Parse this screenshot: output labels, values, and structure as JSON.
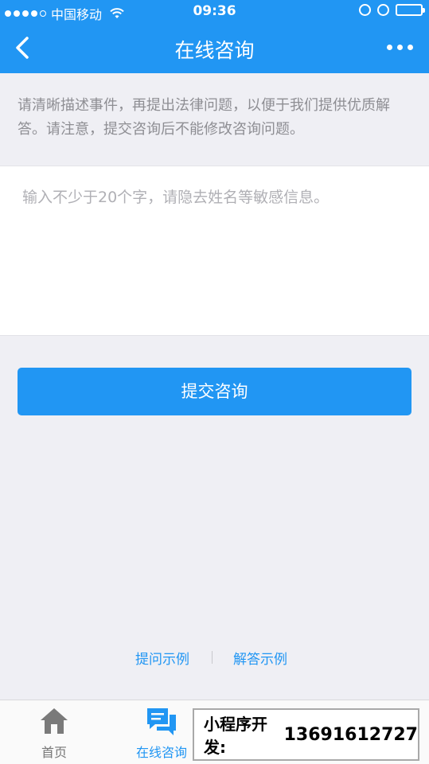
{
  "status_bar": {
    "carrier": "中国移动",
    "time": "09:36"
  },
  "nav": {
    "title": "在线咨询"
  },
  "notice": "请清晰描述事件，再提出法律问题，以便于我们提供优质解答。请注意，提交咨询后不能修改咨询问题。",
  "question": {
    "value": "",
    "placeholder": "输入不少于20个字，请隐去姓名等敏感信息。"
  },
  "submit_label": "提交咨询",
  "links": {
    "ask_example": "提问示例",
    "answer_example": "解答示例"
  },
  "tabbar": {
    "home": "首页",
    "consult": "在线咨询"
  },
  "ad": {
    "label": "小程序开发:",
    "phone": "13691612727"
  },
  "colors": {
    "accent": "#2196f3",
    "background": "#efeff4",
    "muted_text": "#8e8e93"
  },
  "icons": [
    "signal-dots-icon",
    "wifi-icon",
    "lock-rotation-icon",
    "alarm-icon",
    "battery-icon",
    "back-chevron-icon",
    "more-dots-icon",
    "home-icon",
    "chat-bubbles-icon"
  ]
}
